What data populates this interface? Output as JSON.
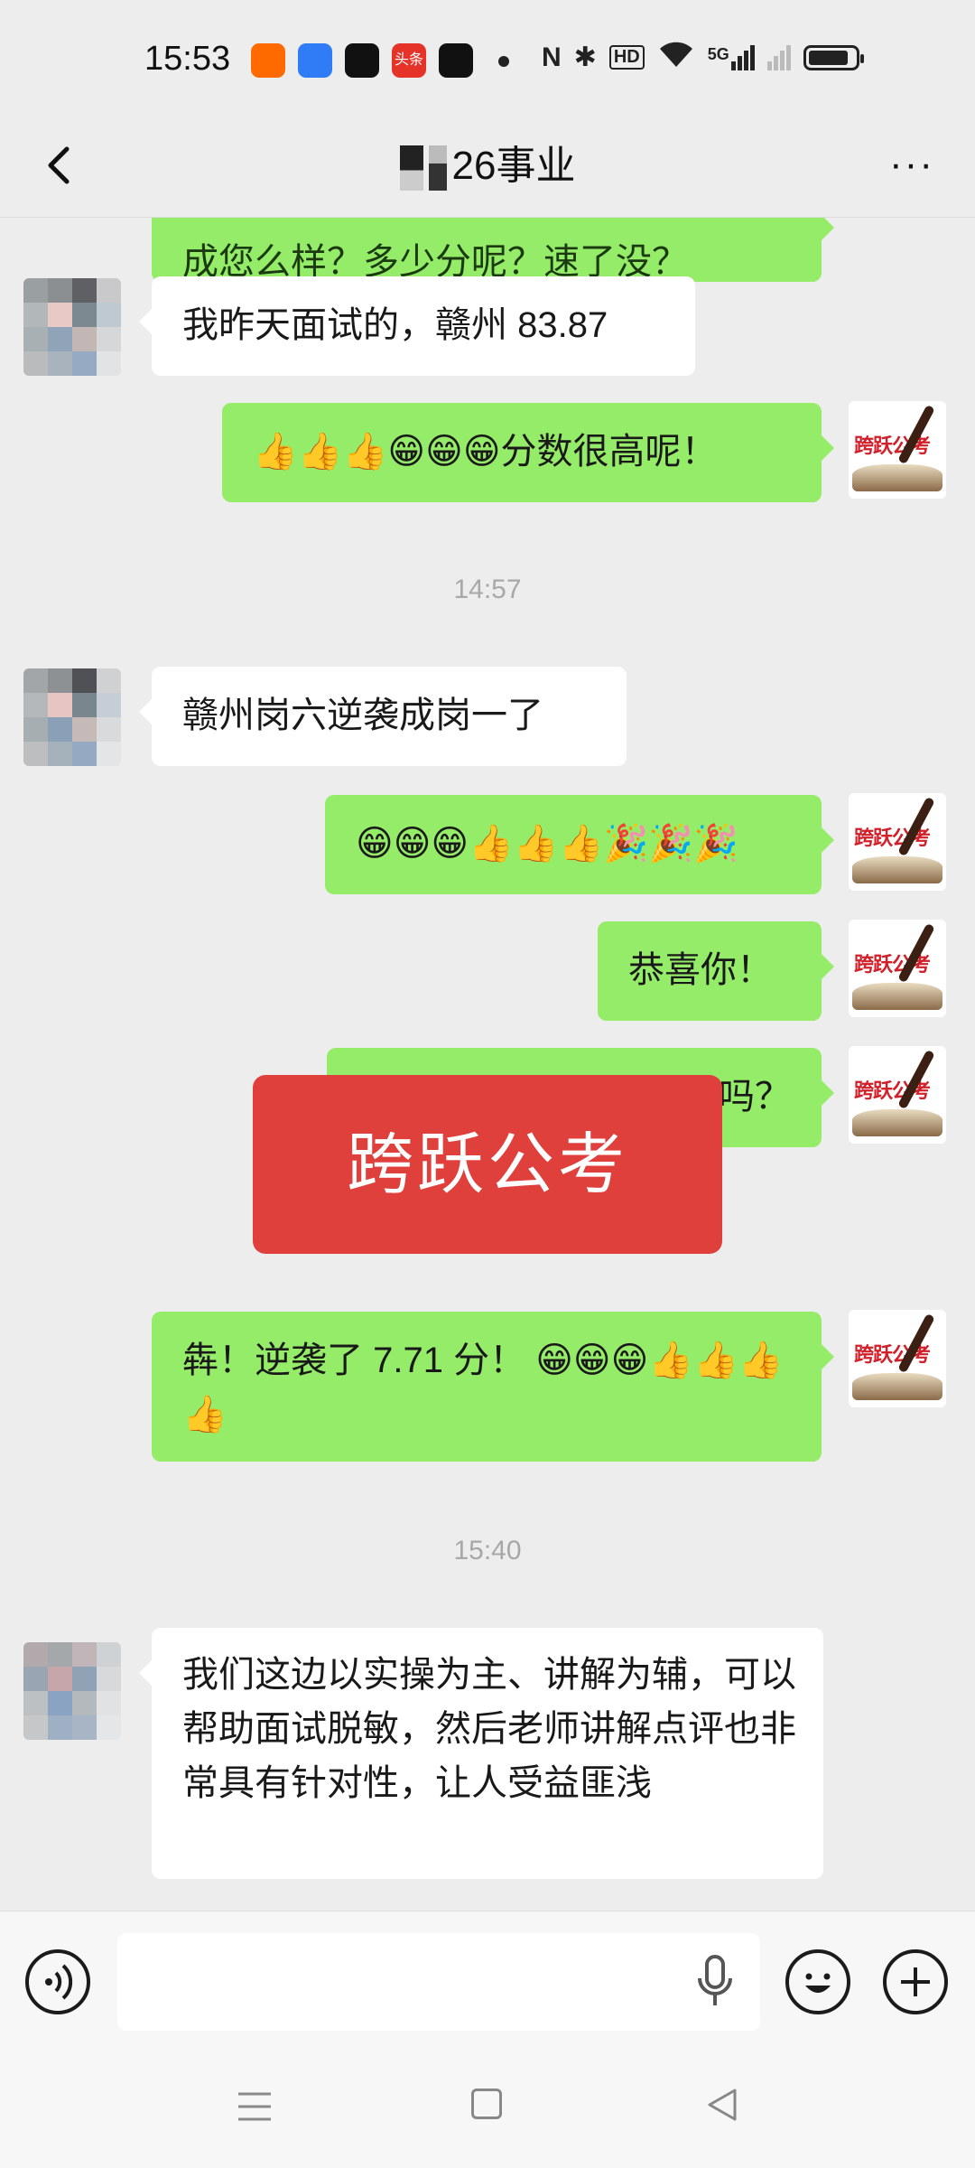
{
  "status_bar": {
    "time": "15:53",
    "app_icons": [
      {
        "name": "taobao-icon",
        "color": "#ff6a00"
      },
      {
        "name": "app-square-icon",
        "color": "#2f7cf6"
      },
      {
        "name": "douyin-icon",
        "color": "#111111"
      },
      {
        "name": "toutiao-icon",
        "color": "#e6332a"
      },
      {
        "name": "douyin-lite-icon",
        "color": "#111111"
      }
    ],
    "toutiao_label": "头条",
    "hd_label": "HD",
    "network_label": "5G",
    "battery_level": 0.85
  },
  "header": {
    "title": "26事业"
  },
  "chat": {
    "messages": [
      {
        "side": "right",
        "text": "成您么样？多少分呢？速了没？"
      },
      {
        "side": "left",
        "text": "我昨天面试的，赣州 83.87"
      },
      {
        "side": "right",
        "text": "👍👍👍😁😁😁分数很高呢！"
      },
      {
        "timestamp": "14:57"
      },
      {
        "side": "left",
        "text": "赣州岗六逆袭成岗一了"
      },
      {
        "side": "right",
        "text": "😁😁😁👍👍👍🎉🎉🎉"
      },
      {
        "side": "right",
        "text": "恭喜你！"
      },
      {
        "side": "right",
        "text": "道吗？"
      },
      {
        "side": "right",
        "text": "犇！逆袭了 7.71 分！ 😁😁😁👍👍👍"
      },
      {
        "timestamp": "15:40"
      },
      {
        "side": "left",
        "text": "我们这边以实操为主、讲解为辅，可以帮助面试脱敏，然后老师讲解点评也非常具有针对性，让人受益匪浅"
      }
    ]
  },
  "watermark": {
    "text": "跨跃公考"
  },
  "avatar_right_label": "跨跃公考",
  "colors": {
    "chat_background": "#ededed",
    "sent_bubble": "#95ec69",
    "received_bubble": "#ffffff",
    "watermark": "#e0403c"
  }
}
